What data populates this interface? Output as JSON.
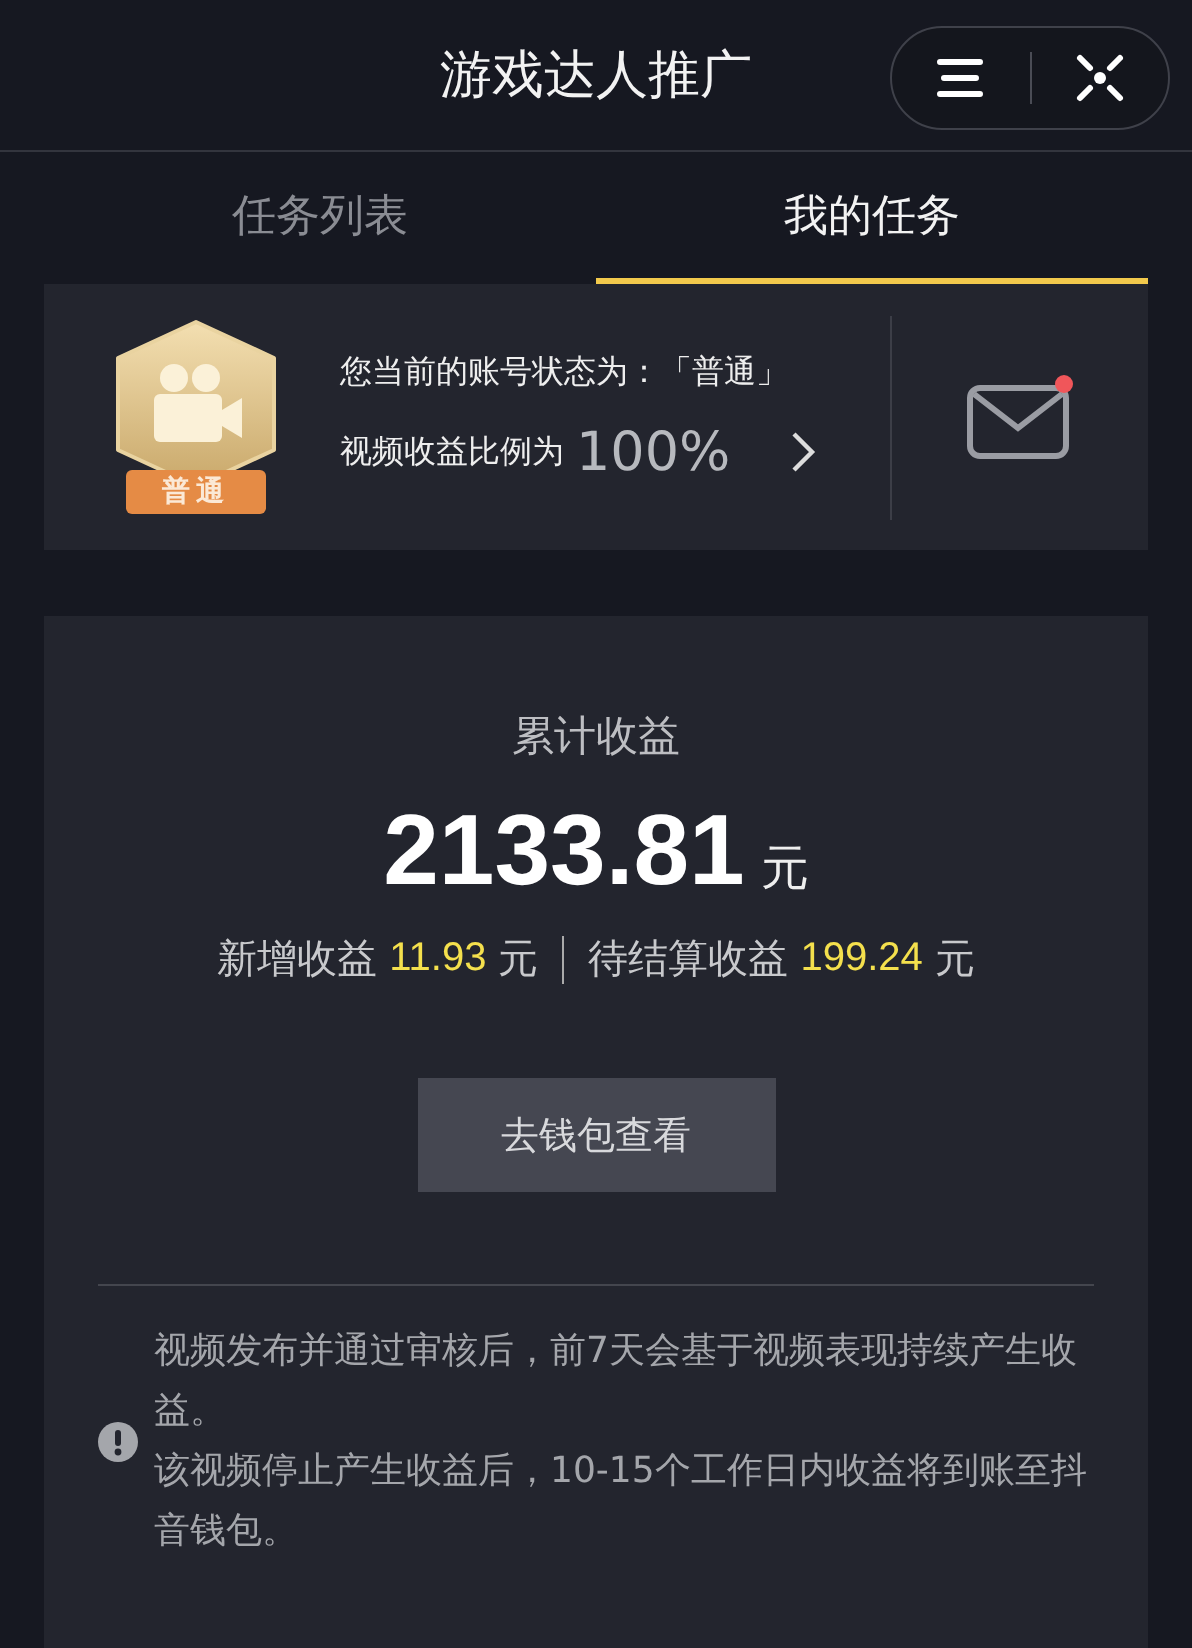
{
  "header": {
    "title": "游戏达人推广"
  },
  "tabs": [
    {
      "label": "任务列表",
      "selected": false
    },
    {
      "label": "我的任务",
      "selected": true
    }
  ],
  "account": {
    "badge_label": "普通",
    "status_text": "您当前的账号状态为：「普通」",
    "ratio_label": "视频收益比例为",
    "ratio_value": "100%",
    "has_unread_mail": true
  },
  "earnings": {
    "title": "累计收益",
    "total": "2133.81",
    "total_unit": "元",
    "new_label": "新增收益",
    "new_value": "11.93",
    "new_unit": "元",
    "pending_label": "待结算收益",
    "pending_value": "199.24",
    "pending_unit": "元",
    "wallet_button": "去钱包查看"
  },
  "notes": [
    "视频发布并通过审核后，前7天会基于视频表现持续产生收益。",
    "该视频停止产生收益后，10-15个工作日内收益将到账至抖音钱包。"
  ]
}
